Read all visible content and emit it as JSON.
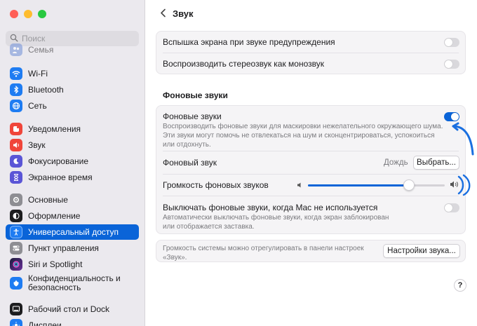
{
  "window": {
    "title": "Звук"
  },
  "search": {
    "placeholder": "Поиск"
  },
  "sidebar": {
    "items": [
      {
        "label": "Семья"
      },
      {
        "label": "Wi-Fi"
      },
      {
        "label": "Bluetooth"
      },
      {
        "label": "Сеть"
      },
      {
        "label": "Уведомления"
      },
      {
        "label": "Звук"
      },
      {
        "label": "Фокусирование"
      },
      {
        "label": "Экранное время"
      },
      {
        "label": "Основные"
      },
      {
        "label": "Оформление"
      },
      {
        "label": "Универсальный доступ",
        "selected": true
      },
      {
        "label": "Пункт управления"
      },
      {
        "label": "Siri и Spotlight"
      },
      {
        "label": "Конфиденциальность и безопасность"
      },
      {
        "label": "Рабочий стол и Dock"
      },
      {
        "label": "Дисплеи"
      }
    ]
  },
  "card1": {
    "flash_label": "Вспышка экрана при звуке предупреждения",
    "flash_on": false,
    "mono_label": "Воспроизводить стереозвук как монозвук",
    "mono_on": false
  },
  "background": {
    "section_title": "Фоновые звуки",
    "toggle_label": "Фоновые звуки",
    "toggle_on": true,
    "toggle_desc": "Воспроизводить фоновые звуки для маскировки нежелательного окружающего шума. Эти звуки могут помочь не отвлекаться на шум и сконцентрироваться, успокоиться или отдохнуть.",
    "sound_label": "Фоновый звук",
    "sound_value": "Дождь",
    "choose_button": "Выбрать...",
    "volume_label": "Громкость фоновых звуков",
    "volume_level": 0.74,
    "disable_label": "Выключать фоновые звуки, когда Mac не используется",
    "disable_on": false,
    "disable_desc": "Автоматически выключать фоновые звуки, когда экран заблокирован или отображается заставка."
  },
  "footer": {
    "note": "Громкость системы можно отрегулировать в панели настроек «Звук».",
    "sound_settings_button": "Настройки звука...",
    "help": "?"
  },
  "colors": {
    "accent": "#0a64d8",
    "sidebar_bg": "#ebe9ee",
    "card_bg": "#f5f4f6"
  },
  "icons": {
    "sidebar": [
      "family-icon",
      "wifi-icon",
      "bluetooth-icon",
      "network-icon",
      "notifications-icon",
      "sound-icon",
      "focus-icon",
      "screen-time-icon",
      "general-icon",
      "appearance-icon",
      "accessibility-icon",
      "control-center-icon",
      "siri-icon",
      "privacy-icon",
      "desktop-dock-icon",
      "displays-icon"
    ]
  }
}
